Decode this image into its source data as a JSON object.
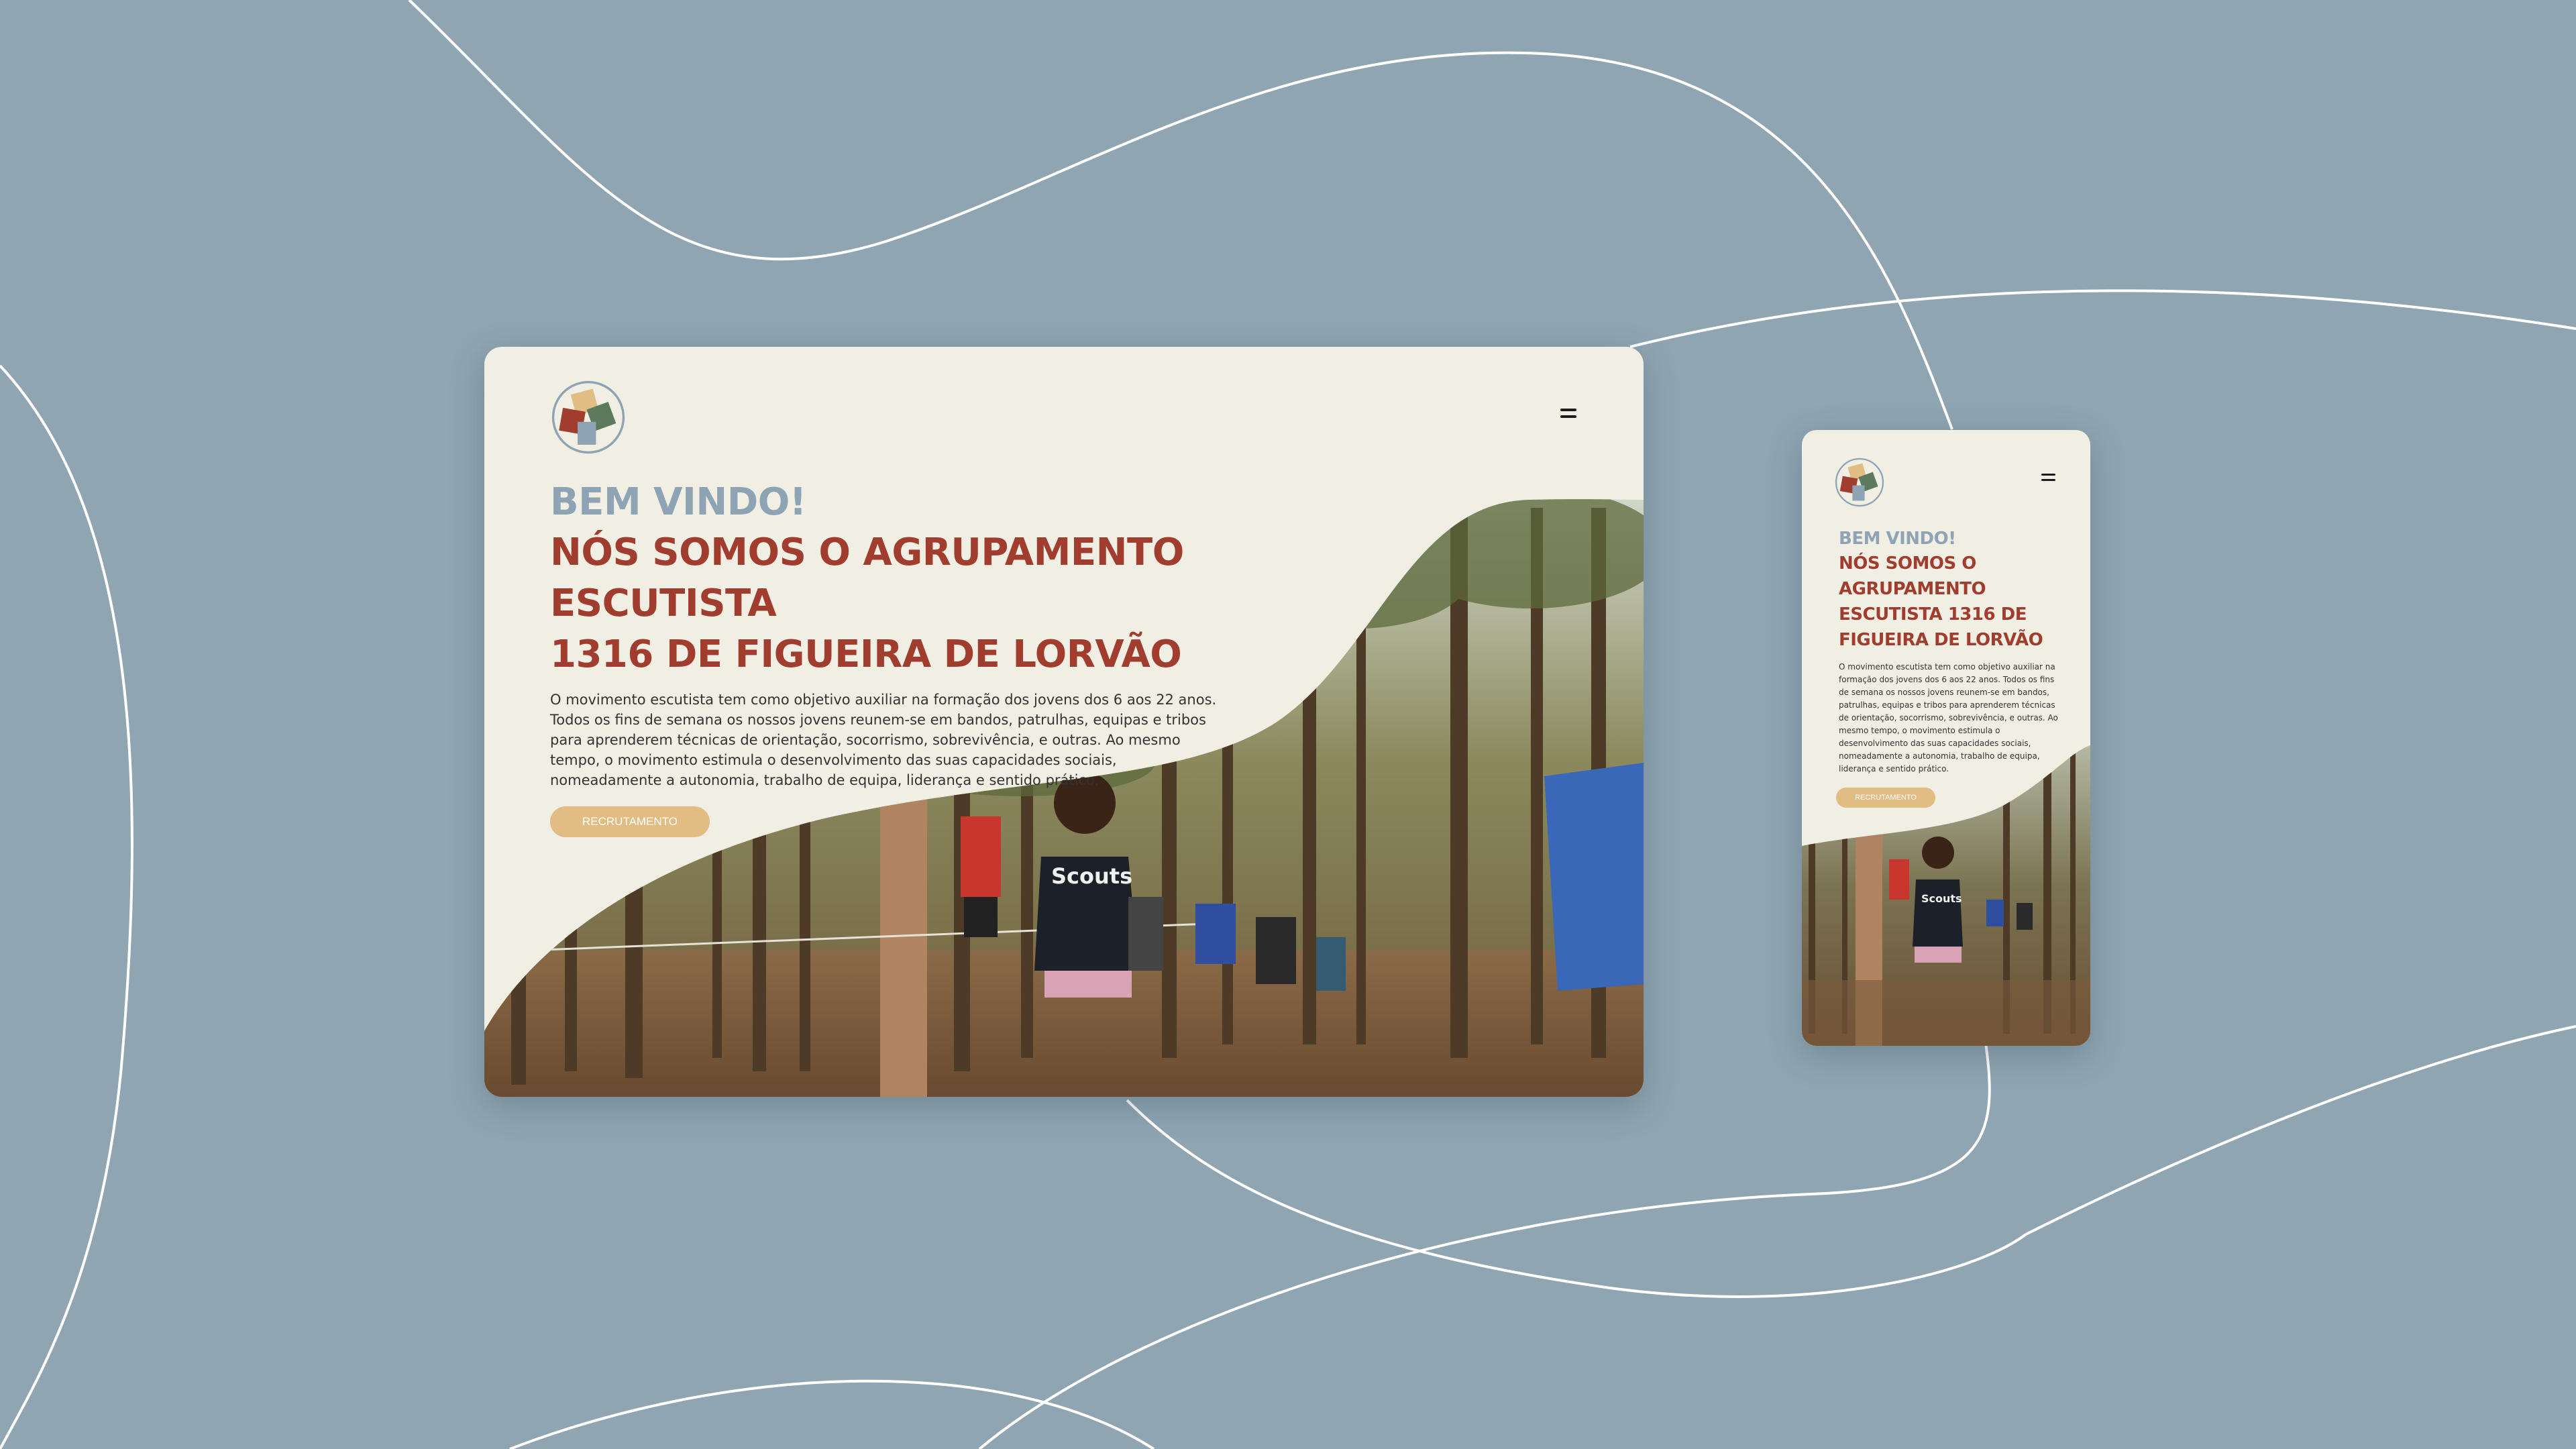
{
  "desktop": {
    "welcome": "BEM VINDO!",
    "title_line1": "NÓS SOMOS O AGRUPAMENTO ESCUTISTA",
    "title_line2": "1316 DE FIGUEIRA DE LORVÃO",
    "body": "O movimento escutista tem como objetivo auxiliar na formação dos jovens dos 6 aos 22 anos. Todos os fins de semana os nossos jovens reunem-se em bandos, patrulhas, equipas e tribos para aprenderem técnicas de orientação, socorrismo, sobrevivência, e outras. Ao mesmo tempo, o movimento estimula o desenvolvimento das suas capacidades sociais, nomeadamente a autonomia, trabalho de equipa, liderança e sentido prático.",
    "cta_label": "RECRUTAMENTO",
    "photo_shirt_text": "Scouts"
  },
  "mobile": {
    "welcome": "BEM VINDO!",
    "title_line1": "NÓS SOMOS O",
    "title_line2": "AGRUPAMENTO",
    "title_line3": "ESCUTISTA 1316 DE",
    "title_line4": "FIGUEIRA DE LORVÃO",
    "body": "O movimento escutista tem como objetivo auxiliar na formação dos jovens dos 6 aos 22 anos. Todos os fins de semana os nossos jovens reunem-se em bandos, patrulhas, equipas e tribos para aprenderem técnicas de orientação, socorrismo, sobrevivência, e outras. Ao mesmo tempo, o movimento estimula o desenvolvimento das suas capacidades sociais, nomeadamente a autonomia, trabalho de equipa, liderança e sentido prático.",
    "cta_label": "RECRUTAMENTO",
    "photo_shirt_text": "Scouts"
  },
  "icons": {
    "logo": "scout-group-logo-icon",
    "menu": "hamburger-menu-icon"
  },
  "colors": {
    "background": "#8fa5b2",
    "card": "#f1eee4",
    "welcome": "#8ea3b3",
    "title": "#a13d2f",
    "button": "#e1bc83"
  }
}
